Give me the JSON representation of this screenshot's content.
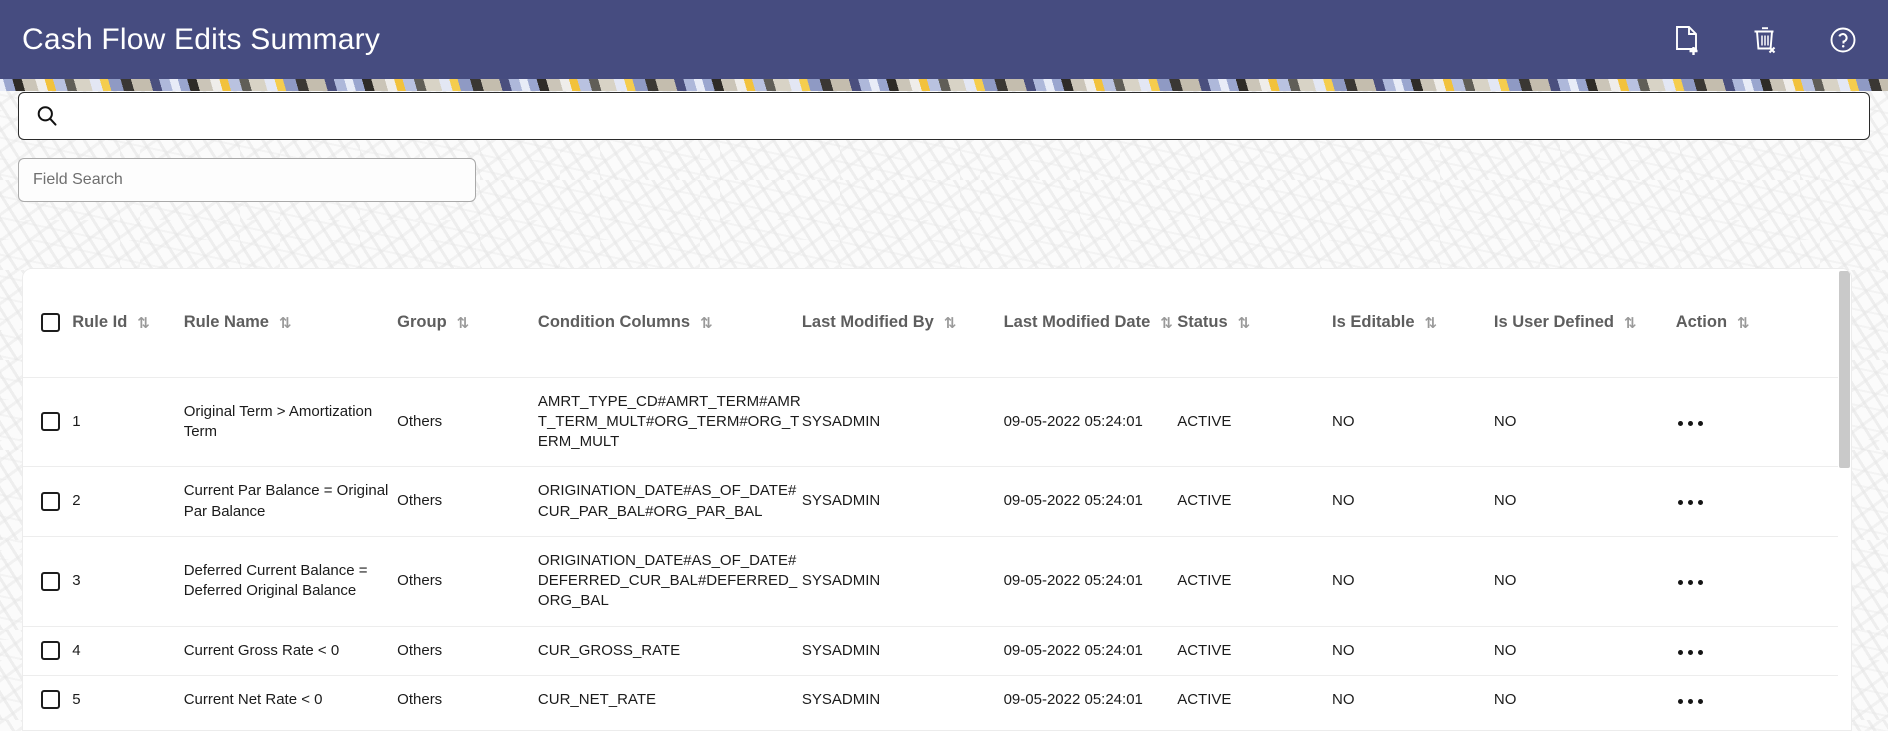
{
  "appbar": {
    "title": "Cash Flow Edits Summary",
    "bg_color": "#464c80",
    "actions": [
      {
        "name": "add-document-icon",
        "label": "Add"
      },
      {
        "name": "delete-icon",
        "label": "Delete"
      },
      {
        "name": "help-icon",
        "label": "Help"
      }
    ]
  },
  "search": {
    "value": "",
    "placeholder": "",
    "icon": "search-icon"
  },
  "field_search": {
    "value": "",
    "placeholder": "Field Search"
  },
  "table": {
    "columns": [
      {
        "key": "rule_id",
        "label": "Rule Id",
        "sortable": true
      },
      {
        "key": "rule_name",
        "label": "Rule Name",
        "sortable": true
      },
      {
        "key": "group",
        "label": "Group",
        "sortable": true
      },
      {
        "key": "cond_columns",
        "label": "Condition Columns",
        "sortable": true
      },
      {
        "key": "last_mod_by",
        "label": "Last Modified By",
        "sortable": true
      },
      {
        "key": "last_mod_date",
        "label": "Last Modified Date",
        "sortable": true
      },
      {
        "key": "status",
        "label": "Status",
        "sortable": true
      },
      {
        "key": "is_editable",
        "label": "Is Editable",
        "sortable": true
      },
      {
        "key": "is_user_def",
        "label": "Is User Defined",
        "sortable": true
      },
      {
        "key": "action",
        "label": "Action",
        "sortable": true
      }
    ],
    "sort_icon": "⇅",
    "select_all_checked": false,
    "rows": [
      {
        "rule_id": "1",
        "rule_name": "Original Term > Amortization Term",
        "group": "Others",
        "cond_columns": "AMRT_TYPE_CD#AMRT_TERM#AMRT_TERM_MULT#ORG_TERM#ORG_TERM_MULT",
        "last_mod_by": "SYSADMIN",
        "last_mod_date": "09-05-2022 05:24:01",
        "status": "ACTIVE",
        "is_editable": "NO",
        "is_user_def": "NO",
        "action": "•••"
      },
      {
        "rule_id": "2",
        "rule_name": "Current Par Balance = Original Par Balance",
        "group": "Others",
        "cond_columns": "ORIGINATION_DATE#AS_OF_DATE#CUR_PAR_BAL#ORG_PAR_BAL",
        "last_mod_by": "SYSADMIN",
        "last_mod_date": "09-05-2022 05:24:01",
        "status": "ACTIVE",
        "is_editable": "NO",
        "is_user_def": "NO",
        "action": "•••"
      },
      {
        "rule_id": "3",
        "rule_name": "Deferred Current Balance = Deferred Original Balance",
        "group": "Others",
        "cond_columns": "ORIGINATION_DATE#AS_OF_DATE#DEFERRED_CUR_BAL#DEFERRED_ORG_BAL",
        "last_mod_by": "SYSADMIN",
        "last_mod_date": "09-05-2022 05:24:01",
        "status": "ACTIVE",
        "is_editable": "NO",
        "is_user_def": "NO",
        "action": "•••"
      },
      {
        "rule_id": "4",
        "rule_name": "Current Gross Rate < 0",
        "group": "Others",
        "cond_columns": "CUR_GROSS_RATE",
        "last_mod_by": "SYSADMIN",
        "last_mod_date": "09-05-2022 05:24:01",
        "status": "ACTIVE",
        "is_editable": "NO",
        "is_user_def": "NO",
        "action": "•••"
      },
      {
        "rule_id": "5",
        "rule_name": "Current Net Rate < 0",
        "group": "Others",
        "cond_columns": "CUR_NET_RATE",
        "last_mod_by": "SYSADMIN",
        "last_mod_date": "09-05-2022 05:24:01",
        "status": "ACTIVE",
        "is_editable": "NO",
        "is_user_def": "NO",
        "action": "•••"
      }
    ]
  }
}
